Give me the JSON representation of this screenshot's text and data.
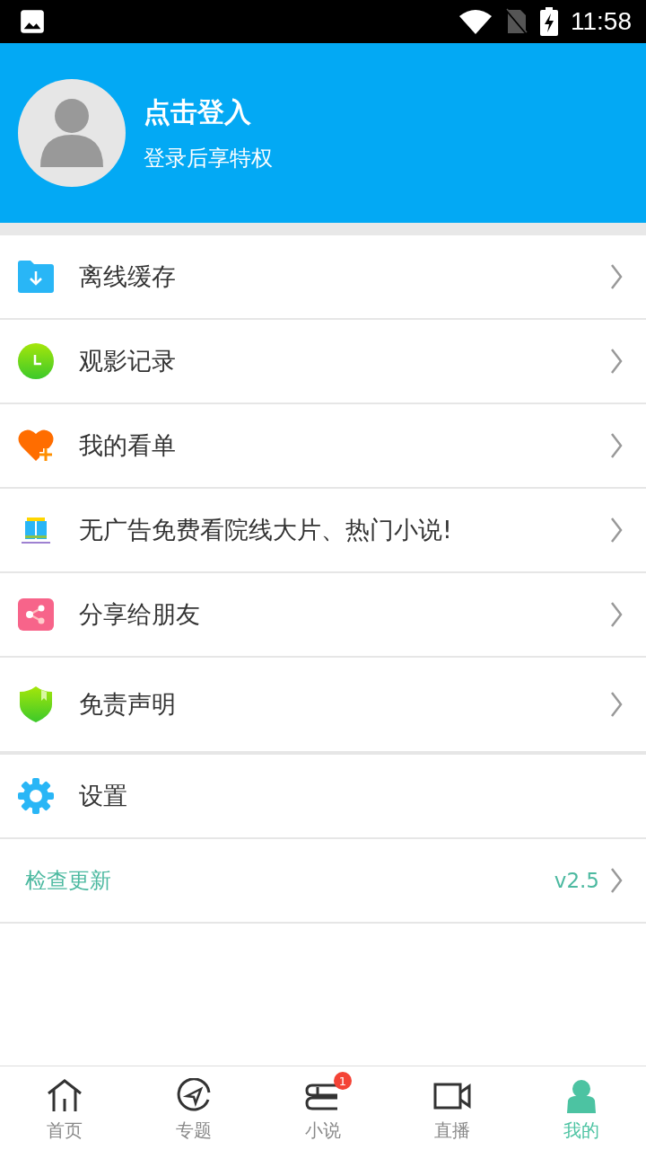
{
  "status_bar": {
    "time": "11:58"
  },
  "profile": {
    "title": "点击登入",
    "subtitle": "登录后享特权"
  },
  "menu_groups": [
    {
      "items": [
        {
          "kind": "link",
          "label": "离线缓存"
        },
        {
          "kind": "link",
          "label": "观影记录"
        },
        {
          "kind": "link",
          "label": "我的看单"
        },
        {
          "kind": "link",
          "label": "无广告免费看院线大片、热门小说!"
        },
        {
          "kind": "link",
          "label": "分享给朋友"
        },
        {
          "kind": "link",
          "label": "免责声明"
        }
      ]
    },
    {
      "items": [
        {
          "kind": "plain",
          "label": "设置"
        },
        {
          "kind": "update",
          "label": "检查更新",
          "value": "v2.5"
        }
      ]
    }
  ],
  "bottom_nav": [
    {
      "label": "首页",
      "selected": false
    },
    {
      "label": "专题",
      "selected": false
    },
    {
      "label": "小说",
      "selected": false,
      "badge": "1"
    },
    {
      "label": "直播",
      "selected": false
    },
    {
      "label": "我的",
      "selected": true
    }
  ]
}
